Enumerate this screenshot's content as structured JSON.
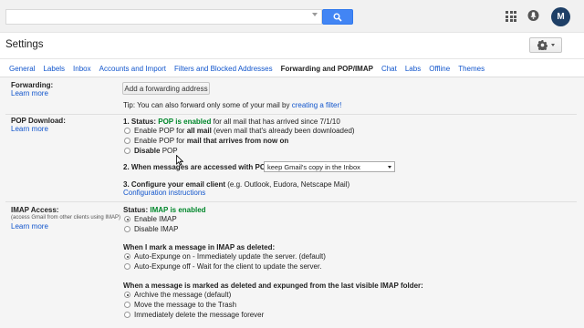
{
  "topbar": {
    "search_value": "",
    "avatar_initial": "M",
    "icons": {
      "search": "search-icon",
      "apps": "apps-grid-icon",
      "notifications": "notifications-icon",
      "settings": "gear-icon"
    },
    "colors": {
      "search_button": "#4285f4",
      "avatar": "#1e3f66"
    }
  },
  "page": {
    "title": "Settings"
  },
  "tabs": [
    {
      "label": "General",
      "active": false
    },
    {
      "label": "Labels",
      "active": false
    },
    {
      "label": "Inbox",
      "active": false
    },
    {
      "label": "Accounts and Import",
      "active": false
    },
    {
      "label": "Filters and Blocked Addresses",
      "active": false
    },
    {
      "label": "Forwarding and POP/IMAP",
      "active": true
    },
    {
      "label": "Chat",
      "active": false
    },
    {
      "label": "Labs",
      "active": false
    },
    {
      "label": "Offline",
      "active": false
    },
    {
      "label": "Themes",
      "active": false
    }
  ],
  "forwarding": {
    "label": "Forwarding:",
    "learn_more": "Learn more",
    "button": "Add a forwarding address",
    "tip_prefix": "Tip: You can also forward only some of your mail by",
    "tip_link": "creating a filter!"
  },
  "pop": {
    "label": "POP Download:",
    "learn_more": "Learn more",
    "status_prefix": "1. Status:",
    "status_value": "POP is enabled",
    "status_suffix": "for all mail that has arrived since 7/1/10",
    "options": [
      {
        "pre": "Enable POP for",
        "bold": "all mail",
        "post": "(even mail that's already been downloaded)",
        "checked": false
      },
      {
        "pre": "Enable POP for",
        "bold": "mail that arrives from now on",
        "post": "",
        "checked": false
      },
      {
        "pre": "",
        "bold": "Disable",
        "post": "POP",
        "checked": false
      }
    ],
    "when_accessed_label": "2. When messages are accessed with POP",
    "when_accessed_value": "keep Gmail's copy in the Inbox",
    "configure_label": "3. Configure your email client",
    "configure_suffix": "(e.g. Outlook, Eudora, Netscape Mail)",
    "configure_link": "Configuration instructions"
  },
  "imap": {
    "label": "IMAP Access:",
    "sublabel": "(access Gmail from other clients using IMAP)",
    "learn_more": "Learn more",
    "status_prefix": "Status:",
    "status_value": "IMAP is enabled",
    "options": [
      {
        "label": "Enable IMAP",
        "checked": true
      },
      {
        "label": "Disable IMAP",
        "checked": false
      }
    ],
    "deleted_heading": "When I mark a message in IMAP as deleted:",
    "deleted_options": [
      {
        "label": "Auto-Expunge on - Immediately update the server. (default)",
        "checked": true
      },
      {
        "label": "Auto-Expunge off - Wait for the client to update the server.",
        "checked": false
      }
    ],
    "expunged_heading": "When a message is marked as deleted and expunged from the last visible IMAP folder:",
    "expunged_options": [
      {
        "label": "Archive the message (default)",
        "checked": true
      },
      {
        "label": "Move the message to the Trash",
        "checked": false
      },
      {
        "label": "Immediately delete the message forever",
        "checked": false
      }
    ]
  }
}
